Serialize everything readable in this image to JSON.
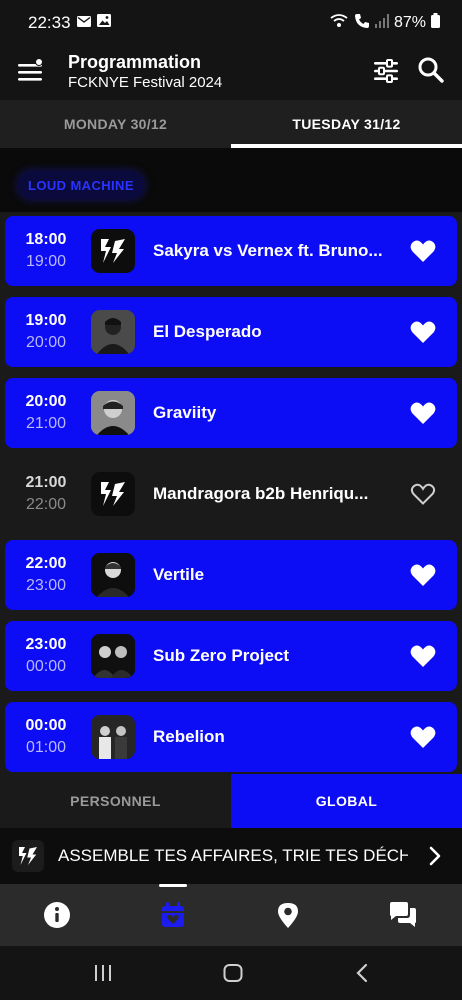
{
  "status_bar": {
    "time": "22:33",
    "battery": "87%"
  },
  "header": {
    "title": "Programmation",
    "subtitle": "FCKNYE Festival 2024"
  },
  "tabs": [
    {
      "label": "MONDAY 30/12",
      "active": false
    },
    {
      "label": "TUESDAY 31/12",
      "active": true
    }
  ],
  "stage": "LOUD MACHINE",
  "slots": [
    {
      "start": "18:00",
      "end": "19:00",
      "artist": "Sakyra vs Vernex ft. Bruno...",
      "favorite": true,
      "avatar": "festival-logo"
    },
    {
      "start": "19:00",
      "end": "20:00",
      "artist": "El Desperado",
      "favorite": true,
      "avatar": "artist-photo"
    },
    {
      "start": "20:00",
      "end": "21:00",
      "artist": "Graviity",
      "favorite": true,
      "avatar": "artist-photo"
    },
    {
      "start": "21:00",
      "end": "22:00",
      "artist": "Mandragora b2b Henriqu...",
      "favorite": false,
      "avatar": "festival-logo"
    },
    {
      "start": "22:00",
      "end": "23:00",
      "artist": "Vertile",
      "favorite": true,
      "avatar": "artist-photo"
    },
    {
      "start": "23:00",
      "end": "00:00",
      "artist": "Sub Zero Project",
      "favorite": true,
      "avatar": "artist-photo"
    },
    {
      "start": "00:00",
      "end": "01:00",
      "artist": "Rebelion",
      "favorite": true,
      "avatar": "artist-photo"
    }
  ],
  "scope_toggle": {
    "personal": "PERSONNEL",
    "global": "GLOBAL",
    "selected": "global"
  },
  "ticker": {
    "text": "ASSEMBLE TES AFFAIRES, TRIE TES DÉCH"
  },
  "bottom_nav": [
    {
      "icon": "info-icon",
      "active": false
    },
    {
      "icon": "calendar-icon",
      "active": true
    },
    {
      "icon": "location-pin-icon",
      "active": false
    },
    {
      "icon": "chat-icon",
      "active": false
    }
  ],
  "colors": {
    "accent": "#0c0cf5",
    "background": "#1a1a1a",
    "stage_text": "#2a33ff"
  }
}
